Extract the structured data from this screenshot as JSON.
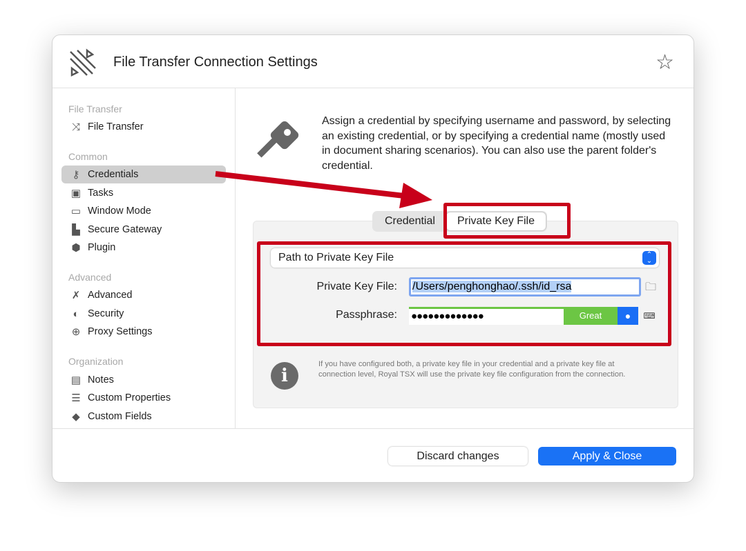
{
  "window": {
    "title": "File Transfer Connection Settings",
    "favorite_icon": "star-icon"
  },
  "sidebar": {
    "sections": [
      {
        "label": "File Transfer",
        "items": [
          {
            "label": "File Transfer",
            "icon": "file-transfer-icon"
          }
        ]
      },
      {
        "label": "Common",
        "items": [
          {
            "label": "Credentials",
            "icon": "key-icon",
            "selected": true
          },
          {
            "label": "Tasks",
            "icon": "tasks-icon"
          },
          {
            "label": "Window Mode",
            "icon": "window-icon"
          },
          {
            "label": "Secure Gateway",
            "icon": "gateway-icon"
          },
          {
            "label": "Plugin",
            "icon": "plugin-icon"
          }
        ]
      },
      {
        "label": "Advanced",
        "items": [
          {
            "label": "Advanced",
            "icon": "tools-icon"
          },
          {
            "label": "Security",
            "icon": "shield-icon"
          },
          {
            "label": "Proxy Settings",
            "icon": "globe-icon"
          }
        ]
      },
      {
        "label": "Organization",
        "items": [
          {
            "label": "Notes",
            "icon": "note-icon"
          },
          {
            "label": "Custom Properties",
            "icon": "list-icon"
          },
          {
            "label": "Custom Fields",
            "icon": "tag-icon"
          }
        ]
      }
    ]
  },
  "main": {
    "description": "Assign a credential by specifying username and password, by selecting an existing credential, or by specifying a credential name (mostly used in document sharing scenarios). You can also use the parent folder's credential.",
    "tabs": [
      {
        "label": "Credential"
      },
      {
        "label": "Private Key File",
        "selected": true
      }
    ],
    "mode_select": "Path to Private Key File",
    "private_key_label": "Private Key File:",
    "private_key_value": "/Users/penghonghao/.ssh/id_rsa",
    "passphrase_label": "Passphrase:",
    "passphrase_value": "●●●●●●●●●●●●●",
    "strength": "Great",
    "info_text": "If you have configured both, a private key file in your credential and a private key file at connection level, Royal TSX will use the private key file configuration from the connection."
  },
  "footer": {
    "discard": "Discard changes",
    "apply": "Apply & Close"
  },
  "colors": {
    "accent": "#1a72f5",
    "annotation": "#c8001a",
    "strength": "#6cc644"
  }
}
